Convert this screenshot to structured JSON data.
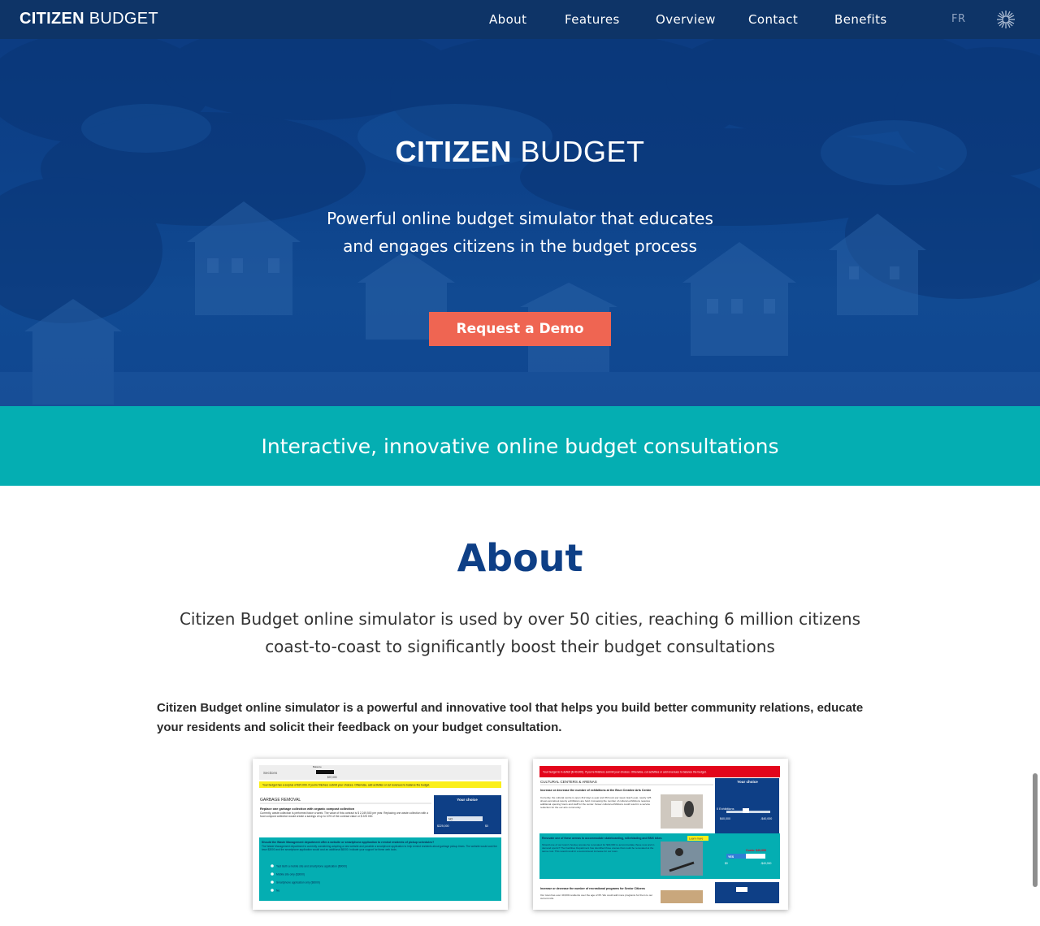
{
  "nav": {
    "logo_bold": "CITIZEN",
    "logo_light": " BUDGET",
    "links": [
      "About",
      "Features",
      "Overview",
      "Contact",
      "Benefits"
    ],
    "lang": "FR",
    "icon": "star-logo-icon"
  },
  "hero": {
    "title_bold": "CITIZEN",
    "title_light": " BUDGET",
    "subtitle": "Powerful online budget simulator that educates and engages citizens in the budget process",
    "button": "Request a Demo"
  },
  "band": {
    "text": "Interactive, innovative online budget consultations"
  },
  "about": {
    "title": "About",
    "lead": "Citizen Budget online simulator is used by over 50 cities, reaching 6 million citizens coast-to-coast to significantly boost their budget consultations",
    "body": "Citizen Budget online simulator is a powerful and innovative tool that helps you build better community relations, educate your residents and solicit their feedback on your budget consultation."
  },
  "shot1": {
    "sections": "Sections",
    "balance_label": "Balance",
    "balance": "$37,000",
    "banner": "Your budget has a surplus of $37,000. If you're finished, submit your choices. Otherwise, add activities or cut revenues to balance the budget.",
    "section": "GARBAGE REMOVAL",
    "your_choice": "Your choice",
    "q1": "Replace one garbage collection with organic compost collection",
    "q1_text": "Currently, waste collection is performed twice a week. The value of this contract is $ 2,249,500 per year. Replacing one waste collection with a food compost collection would create a savings of up to 10% of the contract value or $ 225 000.",
    "slider_val": "NO",
    "amt_left": "$225,000",
    "amt_right": "$0",
    "q2": "Should the Waste Management department offer a website or smartphone application to remind residents of pickup schedules?",
    "q2_text": "The Waste Management department is currently considering adopting a new website and possible a smartphone application to help remind residents about garbage pickup times. The website would cost the town $3000 and the smartphone application would cost an additional $6000. Indicate your support for these web tools.",
    "options": [
      "Yes! Both a mobile site and smartphone application ($9000)",
      "Mobile site only ($3000)",
      "Smartphone application only ($6000)",
      "No"
    ]
  },
  "shot2": {
    "banner": "Your budget is in deficit ($-40,000). If you're finished, submit your choices. Otherwise, cut activities or add revenues to balance the budget.",
    "section": "CULTURAL CENTERS & ARENAS",
    "your_choice": "Your choice",
    "q1": "Increase or decrease the number of exhibitions at the Brun Creative Arts Centre",
    "q1_text": "Currently, the cultural centre is open 312 days a year and 36 hours per week. Each year, nearly 125 shows and about twenty exhibitions are held. Increasing the number of cultural exhibitions requires additional opening hours and staff for the center. Fewer cultural exhibitions could result in a service reduction for the our arts community.",
    "exh_label": "0 Exhibitions",
    "exh_left": "$40,000",
    "exh_right": "-$40,000",
    "q2": "Renovate one of these arenas to accommodate skateboarding, rollerblading and BMX bikes",
    "learn_more": "Learn more",
    "q2_text": "Should one of our town's hockey arenas be renovated for $40,000 to accommodate these new and in demand sports? The Facilities Department has identified three arenas that could be renovated at the same cost. This would result in a second-level increase for our town.",
    "costs": "Costs: $40,000",
    "yes": "YES",
    "y_left": "$0",
    "y_right": "-$40,000",
    "q3": "Increase or decrease the number of recreational programs for Senior Citizens",
    "q3_text": "Our town has over 40,000 residents over the age of 65. We could add more programs for them to our current rolls."
  }
}
